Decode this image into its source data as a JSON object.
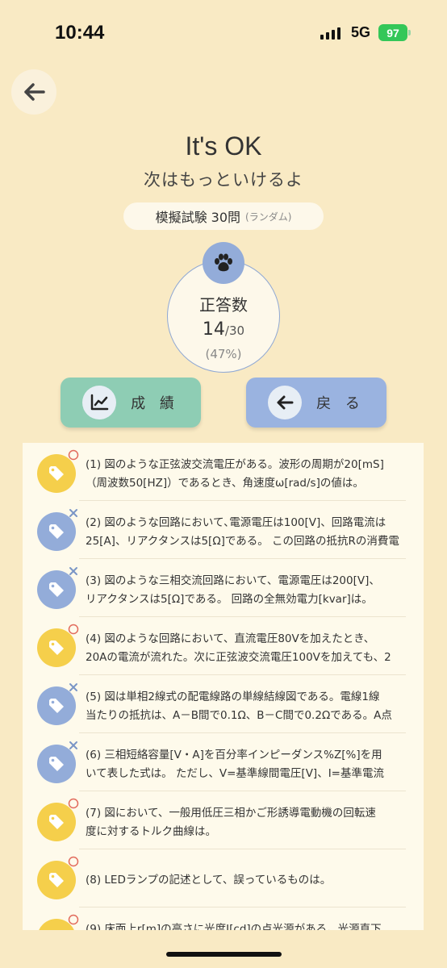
{
  "status_bar": {
    "time": "10:44",
    "network": "5G",
    "battery": "97"
  },
  "header": {
    "title": "It's OK",
    "subtitle": "次はもっといけるよ"
  },
  "exam": {
    "name": "模擬試験 30問",
    "mode": "(ランダム)"
  },
  "score": {
    "label": "正答数",
    "correct": "14",
    "total": "/30",
    "percent": "(47%)"
  },
  "buttons": {
    "results": "成 績",
    "return": "戻 る"
  },
  "colors": {
    "correct": "#f5cf4b",
    "incorrect": "#93acd9",
    "background": "#f9eac4"
  },
  "questions": [
    {
      "result": "correct",
      "line1": "(1) 図のような正弦波交流電圧がある。波形の周期が20[mS]",
      "line2": "（周波数50[HZ]）であるとき、角速度ω[rad/s]の値は。"
    },
    {
      "result": "incorrect",
      "line1": "(2) 図のような回路において､電源電圧は100[V]、回路電流は",
      "line2": "25[A]、リアクタンスは5[Ω]である。 この回路の抵抗Rの消費電"
    },
    {
      "result": "incorrect",
      "line1": "(3) 図のような三相交流回路において、電源電圧は200[V]、",
      "line2": "リアクタンスは5[Ω]である。 回路の全無効電力[kvar]は。"
    },
    {
      "result": "correct",
      "line1": "(4) 図のような回路において、直流電圧80Vを加えたとき、",
      "line2": "20Aの電流が流れた。次に正弦波交流電圧100Vを加えても、2"
    },
    {
      "result": "incorrect",
      "line1": "(5) 図は単相2線式の配電線路の単線結線図である。電線1線",
      "line2": "当たりの抵抗は、A－B間で0.1Ω、B－C間で0.2Ωである。A点"
    },
    {
      "result": "incorrect",
      "line1": "(6) 三相短絡容量[V・A]を百分率インピーダンス%Z[%]を用",
      "line2": "いて表した式は。 ただし、V=基準線間電圧[V]、I=基準電流"
    },
    {
      "result": "correct",
      "line1": "(7) 図において、一般用低圧三相かご形誘導電動機の回転速",
      "line2": "度に対するトルク曲線は。"
    },
    {
      "result": "correct",
      "line1": "(8) LEDランプの記述として、誤っているものは。",
      "line2": ""
    },
    {
      "result": "correct",
      "line1": "(9) 床面上r[m]の高さに光度I[cd]の点光源がある。光源直下",
      "line2": ""
    }
  ]
}
